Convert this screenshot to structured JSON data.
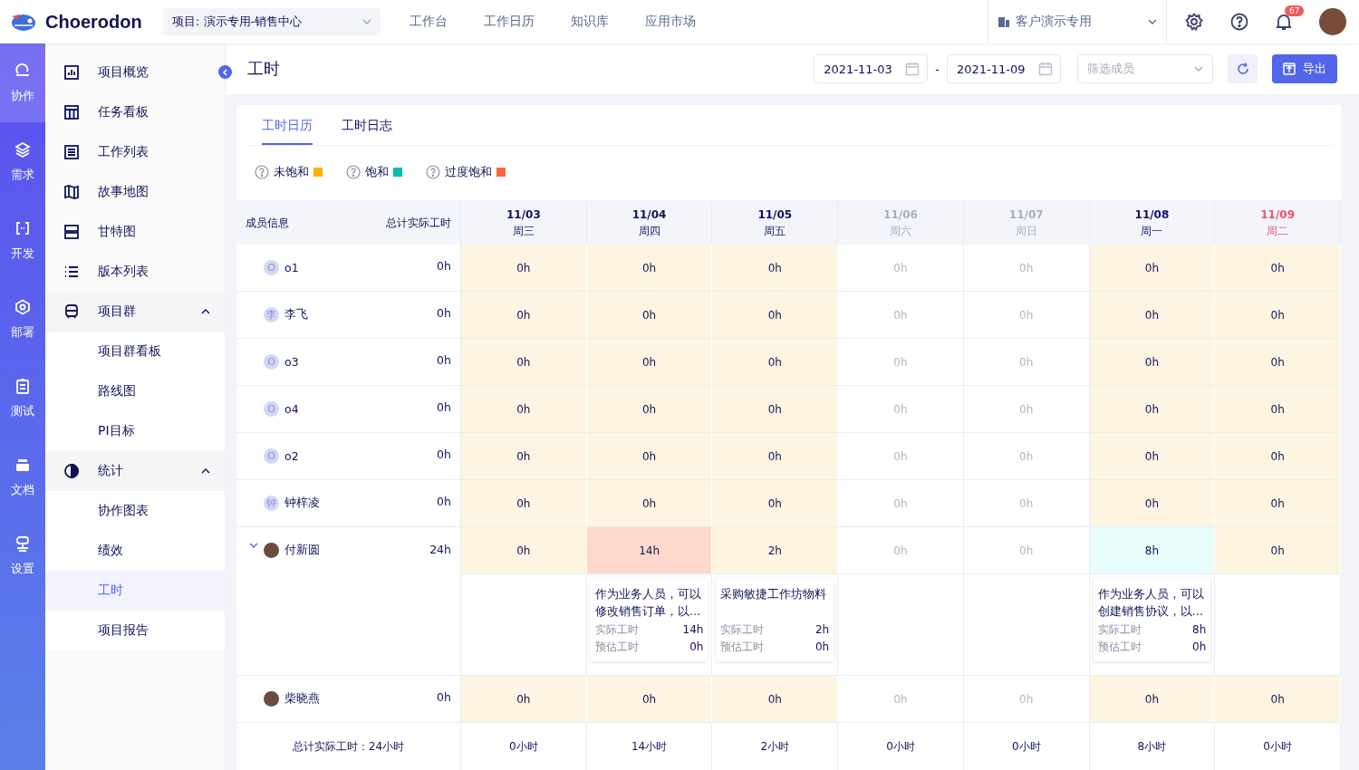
{
  "header": {
    "logo": "Choerodon",
    "project_select": "项目: 演示专用-销售中心",
    "nav": [
      {
        "label": "工作台"
      },
      {
        "label": "工作日历"
      },
      {
        "label": "知识库"
      },
      {
        "label": "应用市场"
      }
    ],
    "org_select": "客户演示专用",
    "notification_count": "67"
  },
  "rail": [
    {
      "label": "协作",
      "selected": true
    },
    {
      "label": "需求",
      "selected": false
    },
    {
      "label": "开发",
      "selected": false
    },
    {
      "label": "部署",
      "selected": false
    },
    {
      "label": "测试",
      "selected": false
    },
    {
      "label": "文档",
      "selected": false
    },
    {
      "label": "设置",
      "selected": false
    }
  ],
  "sidebar": {
    "items": [
      {
        "label": "项目概览",
        "selected": false
      },
      {
        "label": "任务看板",
        "selected": false
      },
      {
        "label": "工作列表",
        "selected": false
      },
      {
        "label": "故事地图",
        "selected": false
      },
      {
        "label": "甘特图",
        "selected": false
      },
      {
        "label": "版本列表",
        "selected": false
      },
      {
        "label": "项目群",
        "selected": false,
        "expanded": true,
        "children": [
          {
            "label": "项目群看板",
            "selected": false
          },
          {
            "label": "路线图",
            "selected": false
          },
          {
            "label": "PI目标",
            "selected": false
          }
        ]
      },
      {
        "label": "统计",
        "selected": false,
        "expanded": true,
        "children": [
          {
            "label": "协作图表",
            "selected": false
          },
          {
            "label": "绩效",
            "selected": false
          },
          {
            "label": "工时",
            "selected": true
          },
          {
            "label": "项目报告",
            "selected": false
          }
        ]
      }
    ]
  },
  "page": {
    "title": "工时",
    "start_date": "2021-11-03",
    "separator": "-",
    "end_date": "2021-11-09",
    "member_filter_placeholder": "筛选成员",
    "export_button": "导出"
  },
  "tabs": [
    {
      "label": "工时日历",
      "selected": true
    },
    {
      "label": "工时日志",
      "selected": false
    }
  ],
  "legend": [
    {
      "label": "未饱和",
      "color": "#ffb100"
    },
    {
      "label": "饱和",
      "color": "#00bfa5"
    },
    {
      "label": "过度饱和",
      "color": "#ff6939"
    }
  ],
  "table": {
    "member_header": "成员信息",
    "total_header": "总计实际工时",
    "days": [
      {
        "date": "11/03",
        "weekday": "周三",
        "kind": "workday"
      },
      {
        "date": "11/04",
        "weekday": "周四",
        "kind": "workday"
      },
      {
        "date": "11/05",
        "weekday": "周五",
        "kind": "workday"
      },
      {
        "date": "11/06",
        "weekday": "周六",
        "kind": "weekend"
      },
      {
        "date": "11/07",
        "weekday": "周日",
        "kind": "weekend"
      },
      {
        "date": "11/08",
        "weekday": "周一",
        "kind": "workday"
      },
      {
        "date": "11/09",
        "weekday": "周二",
        "kind": "today"
      }
    ],
    "rows": [
      {
        "name": "o1",
        "avatar": {
          "kind": "initial",
          "text": "O"
        },
        "total": "0h",
        "expanded": false,
        "cells": [
          {
            "hours": "0h",
            "kind": "under"
          },
          {
            "hours": "0h",
            "kind": "under"
          },
          {
            "hours": "0h",
            "kind": "under"
          },
          {
            "hours": "0h",
            "kind": "off"
          },
          {
            "hours": "0h",
            "kind": "off"
          },
          {
            "hours": "0h",
            "kind": "under"
          },
          {
            "hours": "0h",
            "kind": "under"
          }
        ]
      },
      {
        "name": "李飞",
        "avatar": {
          "kind": "initial",
          "text": "李"
        },
        "total": "0h",
        "expanded": false,
        "cells": [
          {
            "hours": "0h",
            "kind": "under"
          },
          {
            "hours": "0h",
            "kind": "under"
          },
          {
            "hours": "0h",
            "kind": "under"
          },
          {
            "hours": "0h",
            "kind": "off"
          },
          {
            "hours": "0h",
            "kind": "off"
          },
          {
            "hours": "0h",
            "kind": "under"
          },
          {
            "hours": "0h",
            "kind": "under"
          }
        ]
      },
      {
        "name": "o3",
        "avatar": {
          "kind": "initial",
          "text": "O"
        },
        "total": "0h",
        "expanded": false,
        "cells": [
          {
            "hours": "0h",
            "kind": "under"
          },
          {
            "hours": "0h",
            "kind": "under"
          },
          {
            "hours": "0h",
            "kind": "under"
          },
          {
            "hours": "0h",
            "kind": "off"
          },
          {
            "hours": "0h",
            "kind": "off"
          },
          {
            "hours": "0h",
            "kind": "under"
          },
          {
            "hours": "0h",
            "kind": "under"
          }
        ]
      },
      {
        "name": "o4",
        "avatar": {
          "kind": "initial",
          "text": "O"
        },
        "total": "0h",
        "expanded": false,
        "cells": [
          {
            "hours": "0h",
            "kind": "under"
          },
          {
            "hours": "0h",
            "kind": "under"
          },
          {
            "hours": "0h",
            "kind": "under"
          },
          {
            "hours": "0h",
            "kind": "off"
          },
          {
            "hours": "0h",
            "kind": "off"
          },
          {
            "hours": "0h",
            "kind": "under"
          },
          {
            "hours": "0h",
            "kind": "under"
          }
        ]
      },
      {
        "name": "o2",
        "avatar": {
          "kind": "initial",
          "text": "O"
        },
        "total": "0h",
        "expanded": false,
        "cells": [
          {
            "hours": "0h",
            "kind": "under"
          },
          {
            "hours": "0h",
            "kind": "under"
          },
          {
            "hours": "0h",
            "kind": "under"
          },
          {
            "hours": "0h",
            "kind": "off"
          },
          {
            "hours": "0h",
            "kind": "off"
          },
          {
            "hours": "0h",
            "kind": "under"
          },
          {
            "hours": "0h",
            "kind": "under"
          }
        ]
      },
      {
        "name": "钟梓凌",
        "avatar": {
          "kind": "initial",
          "text": "钟"
        },
        "total": "0h",
        "expanded": false,
        "cells": [
          {
            "hours": "0h",
            "kind": "under"
          },
          {
            "hours": "0h",
            "kind": "under"
          },
          {
            "hours": "0h",
            "kind": "under"
          },
          {
            "hours": "0h",
            "kind": "off"
          },
          {
            "hours": "0h",
            "kind": "off"
          },
          {
            "hours": "0h",
            "kind": "under"
          },
          {
            "hours": "0h",
            "kind": "under"
          }
        ]
      },
      {
        "name": "付新圆",
        "avatar": {
          "kind": "photo"
        },
        "total": "24h",
        "expanded": true,
        "cells": [
          {
            "hours": "0h",
            "kind": "under"
          },
          {
            "hours": "14h",
            "kind": "over"
          },
          {
            "hours": "2h",
            "kind": "under"
          },
          {
            "hours": "0h",
            "kind": "off"
          },
          {
            "hours": "0h",
            "kind": "off"
          },
          {
            "hours": "8h",
            "kind": "full"
          },
          {
            "hours": "0h",
            "kind": "under"
          }
        ],
        "details": [
          {
            "kind": "empty"
          },
          {
            "kind": "card",
            "title": "作为业务人员，可以修改销售订单，以…",
            "actual_label": "实际工时",
            "actual": "14h",
            "estimate_label": "预估工时",
            "estimate": "0h"
          },
          {
            "kind": "card",
            "title": "采购敏捷工作坊物料",
            "actual_label": "实际工时",
            "actual": "2h",
            "estimate_label": "预估工时",
            "estimate": "0h"
          },
          {
            "kind": "empty"
          },
          {
            "kind": "empty"
          },
          {
            "kind": "card",
            "title": "作为业务人员，可以创建销售协议，以…",
            "actual_label": "实际工时",
            "actual": "8h",
            "estimate_label": "预估工时",
            "estimate": "0h"
          },
          {
            "kind": "empty"
          }
        ]
      },
      {
        "name": "柴晓燕",
        "avatar": {
          "kind": "photo"
        },
        "total": "0h",
        "expanded": false,
        "cells": [
          {
            "hours": "0h",
            "kind": "under"
          },
          {
            "hours": "0h",
            "kind": "under"
          },
          {
            "hours": "0h",
            "kind": "under"
          },
          {
            "hours": "0h",
            "kind": "off"
          },
          {
            "hours": "0h",
            "kind": "off"
          },
          {
            "hours": "0h",
            "kind": "under"
          },
          {
            "hours": "0h",
            "kind": "under"
          }
        ]
      }
    ],
    "footer": {
      "label": "总计实际工时：24小时",
      "days": [
        "0小时",
        "14小时",
        "2小时",
        "0小时",
        "0小时",
        "8小时",
        "0小时"
      ]
    }
  }
}
